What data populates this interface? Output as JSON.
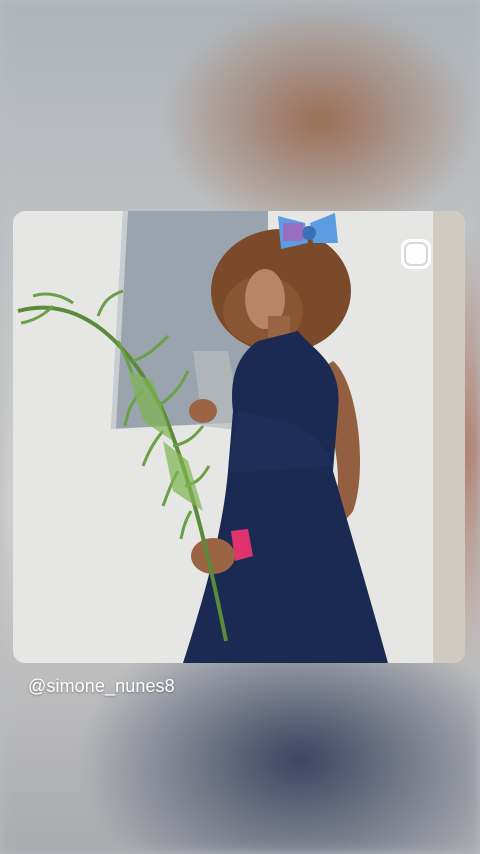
{
  "post": {
    "username": "@simone_nunes8"
  },
  "icons": {
    "corner": "instagram-icon"
  }
}
